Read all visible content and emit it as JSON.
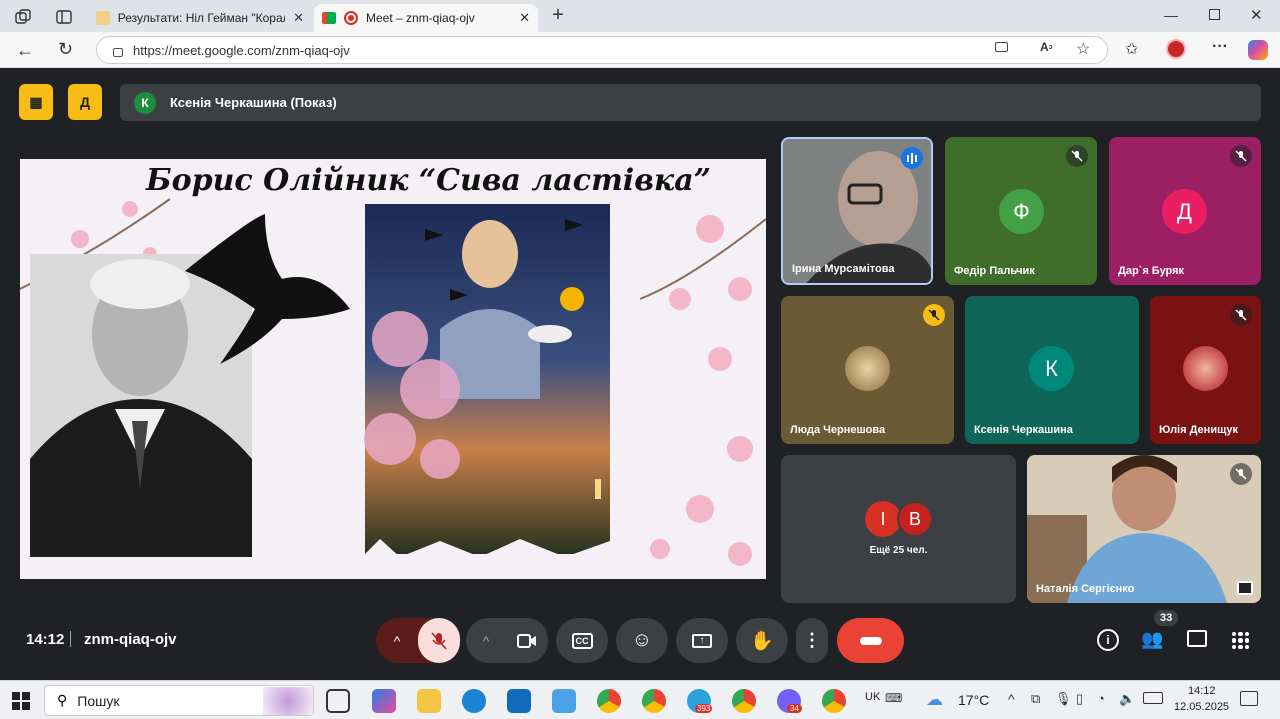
{
  "browser": {
    "tabs": [
      {
        "label": "Результати: Ніл Гейман \"Коралі",
        "active": false
      },
      {
        "label": "Meet – znm-qiaq-ojv",
        "active": true
      }
    ],
    "url": "https://meet.google.com/znm-qiaq-ojv"
  },
  "meet": {
    "presenter_initial": "К",
    "presenter_label": "Ксенія Черкашина (Показ)",
    "slide": {
      "title": "Борис Олійник “Сива ластівка”"
    },
    "participants": [
      {
        "name": "Ірина Мурсамітова",
        "type": "video",
        "speaking": true
      },
      {
        "name": "Федір Пальчик",
        "initial": "Ф",
        "bg": "#33691e",
        "avatar": "#43a047"
      },
      {
        "name": "Дар`я Буряк",
        "initial": "Д",
        "bg": "#8e1c5b",
        "avatar": "#e91e63"
      },
      {
        "name": "Люда Чернешова",
        "type": "photo",
        "bg": "#5d4a2c"
      },
      {
        "name": "Ксенія Черкашина",
        "initial": "К",
        "bg": "#0e5951",
        "avatar": "#00897b"
      },
      {
        "name": "Юлія Денищук",
        "type": "photo",
        "bg": "#8a1414"
      },
      {
        "name": "Наталія Сергієнко",
        "type": "video"
      }
    ],
    "others": {
      "initials": [
        "І",
        "В"
      ],
      "label": "Ещё 25 чел."
    },
    "time": "14:12",
    "code": "znm-qiaq-ojv",
    "people_count": "33"
  },
  "taskbar": {
    "search": "Пошук",
    "lang": "UK",
    "weather": "17°C",
    "clock_time": "14:12",
    "clock_date": "12.05.2025",
    "badges": {
      "telegram": "393",
      "viber": "34"
    }
  }
}
